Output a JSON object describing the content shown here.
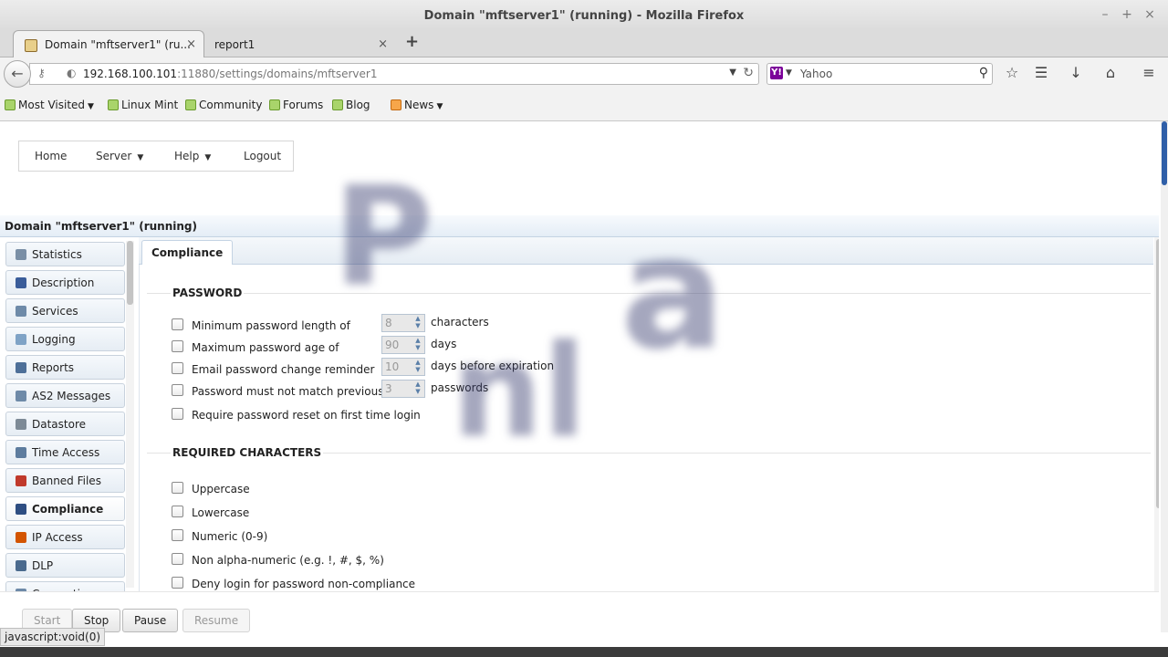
{
  "window": {
    "title": "Domain \"mftserver1\" (running) - Mozilla Firefox",
    "minimize": "–",
    "maximize": "+",
    "close": "×"
  },
  "tabs": [
    {
      "label": "Domain \"mftserver1\" (ru...",
      "close": "×"
    },
    {
      "label": "report1",
      "close": "×"
    }
  ],
  "new_tab": "+",
  "nav": {
    "back": "←",
    "url_host": "192.168.100.101",
    "url_rest": ":11880/settings/domains/mftserver1",
    "dropdown": "▼",
    "reload": "↻",
    "search_engine_glyph": "Y!",
    "search_placeholder": "Yahoo"
  },
  "toolbar_icons": {
    "bookmark_star": "☆",
    "reading_list": "☰",
    "downloads": "↓",
    "home": "⌂",
    "menu": "≡"
  },
  "bookmarks": [
    {
      "label": "Most Visited",
      "has_caret": true
    },
    {
      "label": "Linux Mint"
    },
    {
      "label": "Community"
    },
    {
      "label": "Forums"
    },
    {
      "label": "Blog"
    },
    {
      "label": "News",
      "has_caret": true
    }
  ],
  "topnav": {
    "home": "Home",
    "server": "Server",
    "help": "Help",
    "logout": "Logout"
  },
  "domain_header": "Domain \"mftserver1\" (running)",
  "sidebar": [
    {
      "label": "Statistics",
      "icon": "statistics-icon",
      "color": "#7a8fa6"
    },
    {
      "label": "Description",
      "icon": "description-icon",
      "color": "#3a5d9a"
    },
    {
      "label": "Services",
      "icon": "services-icon",
      "color": "#6e8aa8"
    },
    {
      "label": "Logging",
      "icon": "logging-icon",
      "color": "#7fa3c6"
    },
    {
      "label": "Reports",
      "icon": "reports-icon",
      "color": "#4d6f98"
    },
    {
      "label": "AS2 Messages",
      "icon": "as2-icon",
      "color": "#6e8aa8"
    },
    {
      "label": "Datastore",
      "icon": "datastore-icon",
      "color": "#7d8a96"
    },
    {
      "label": "Time Access",
      "icon": "time-access-icon",
      "color": "#5d7c9e"
    },
    {
      "label": "Banned Files",
      "icon": "banned-files-icon",
      "color": "#c0392b"
    },
    {
      "label": "Compliance",
      "icon": "compliance-icon",
      "color": "#2e4e82",
      "selected": true
    },
    {
      "label": "IP Access",
      "icon": "ip-access-icon",
      "color": "#d35400"
    },
    {
      "label": "DLP",
      "icon": "dlp-icon",
      "color": "#4a6a8e"
    },
    {
      "label": "Connections",
      "icon": "connections-icon",
      "color": "#6e8aa8"
    }
  ],
  "panel_tab": "Compliance",
  "password_section": {
    "title": "PASSWORD",
    "rows": [
      {
        "label": "Minimum password length of",
        "value": "8",
        "unit": "characters"
      },
      {
        "label": "Maximum password age of",
        "value": "90",
        "unit": "days"
      },
      {
        "label": "Email password change reminder",
        "value": "10",
        "unit": "days before expiration"
      },
      {
        "label": "Password must not match previous",
        "value": "3",
        "unit": "passwords"
      },
      {
        "label": "Require password reset on first time login"
      }
    ]
  },
  "required_section": {
    "title": "REQUIRED CHARACTERS",
    "rows": [
      {
        "label": "Uppercase"
      },
      {
        "label": "Lowercase"
      },
      {
        "label": "Numeric (0-9)"
      },
      {
        "label": "Non alpha-numeric (e.g. !, #, $, %)"
      },
      {
        "label": "Deny login for password non-compliance"
      }
    ]
  },
  "buttons": {
    "start": "Start",
    "stop": "Stop",
    "pause": "Pause",
    "resume": "Resume"
  },
  "status_text": "javascript:void(0)"
}
